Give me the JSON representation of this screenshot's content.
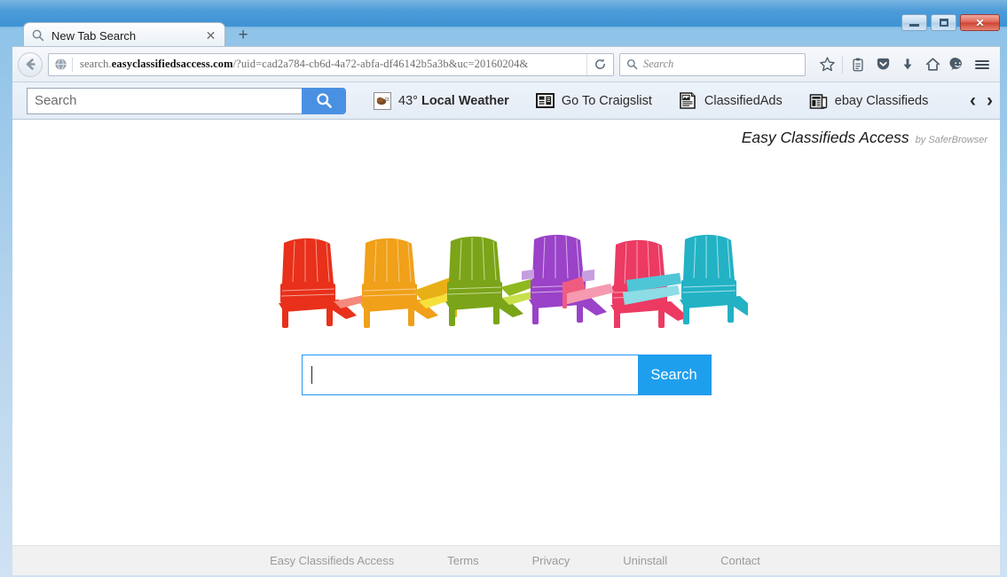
{
  "window": {
    "controls": {
      "minimize": "–",
      "maximize": "□",
      "close": "✕"
    }
  },
  "browser": {
    "tab": {
      "title": "New Tab Search",
      "favicon": "search-icon",
      "close_label": "✕"
    },
    "new_tab_label": "+",
    "back_label": "back-arrow-icon",
    "url": {
      "prefix": "search.",
      "domain": "easyclassifiedsaccess.com",
      "path": "/?uid=cad2a784-cb6d-4a72-abfa-df46142b5a3b&uc=20160204&",
      "full": "search.easyclassifiedsaccess.com/?uid=cad2a784-cb6d-4a72-abfa-df46142b5a3b&uc=20160204&"
    },
    "reload_label": "reload-icon",
    "search_field": {
      "placeholder": "Search",
      "value": ""
    },
    "toolbar_icons": [
      {
        "name": "bookmark-star-icon",
        "glyph": "☆"
      },
      {
        "name": "reader-mode-icon",
        "glyph": "📋"
      },
      {
        "name": "pocket-icon",
        "glyph": "▽"
      },
      {
        "name": "downloads-icon",
        "glyph": "⬇"
      },
      {
        "name": "home-icon",
        "glyph": "⌂"
      },
      {
        "name": "sync-chat-icon",
        "glyph": "☺"
      },
      {
        "name": "hamburger-menu-icon",
        "glyph": "☰"
      }
    ]
  },
  "extension_toolbar": {
    "search": {
      "placeholder": "Search",
      "value": "",
      "button_icon": "search-icon"
    },
    "links": [
      {
        "label_prefix": "43° ",
        "label": "Local Weather",
        "icon": "weather-icon",
        "name": "local-weather"
      },
      {
        "label_prefix": "",
        "label": "Go To Craigslist",
        "icon": "newspaper-icon",
        "name": "go-to-craigslist"
      },
      {
        "label_prefix": "",
        "label": "ClassifiedAds",
        "icon": "classified-ads-icon",
        "name": "classified-ads"
      },
      {
        "label_prefix": "",
        "label": "ebay Classifieds",
        "icon": "folded-newspaper-icon",
        "name": "ebay-classifieds"
      }
    ],
    "nav": {
      "prev": "‹",
      "next": "›"
    }
  },
  "page": {
    "brand": {
      "name": "Easy Classifieds Access",
      "by": "by SaferBrowser"
    },
    "hero": {
      "image_name": "colorful-adirondack-chairs",
      "chair_colors": [
        "#e8301a",
        "#f0a019",
        "#7ba418",
        "#9a42c8",
        "#ec3a63",
        "#22b2c4"
      ]
    },
    "search": {
      "value": "",
      "placeholder": "",
      "button_label": "Search"
    },
    "footer_links": [
      "Easy Classifieds Access",
      "Terms",
      "Privacy",
      "Uninstall",
      "Contact"
    ]
  },
  "colors": {
    "window_border": "#1d7ec9",
    "accent_blue": "#4a90e2",
    "search_blue": "#1e9fed",
    "search_border": "#2196f3",
    "toolbar_bg": "#e8eef7",
    "footer_bg": "#f1f1f1",
    "footer_text": "#9a9a9a"
  }
}
